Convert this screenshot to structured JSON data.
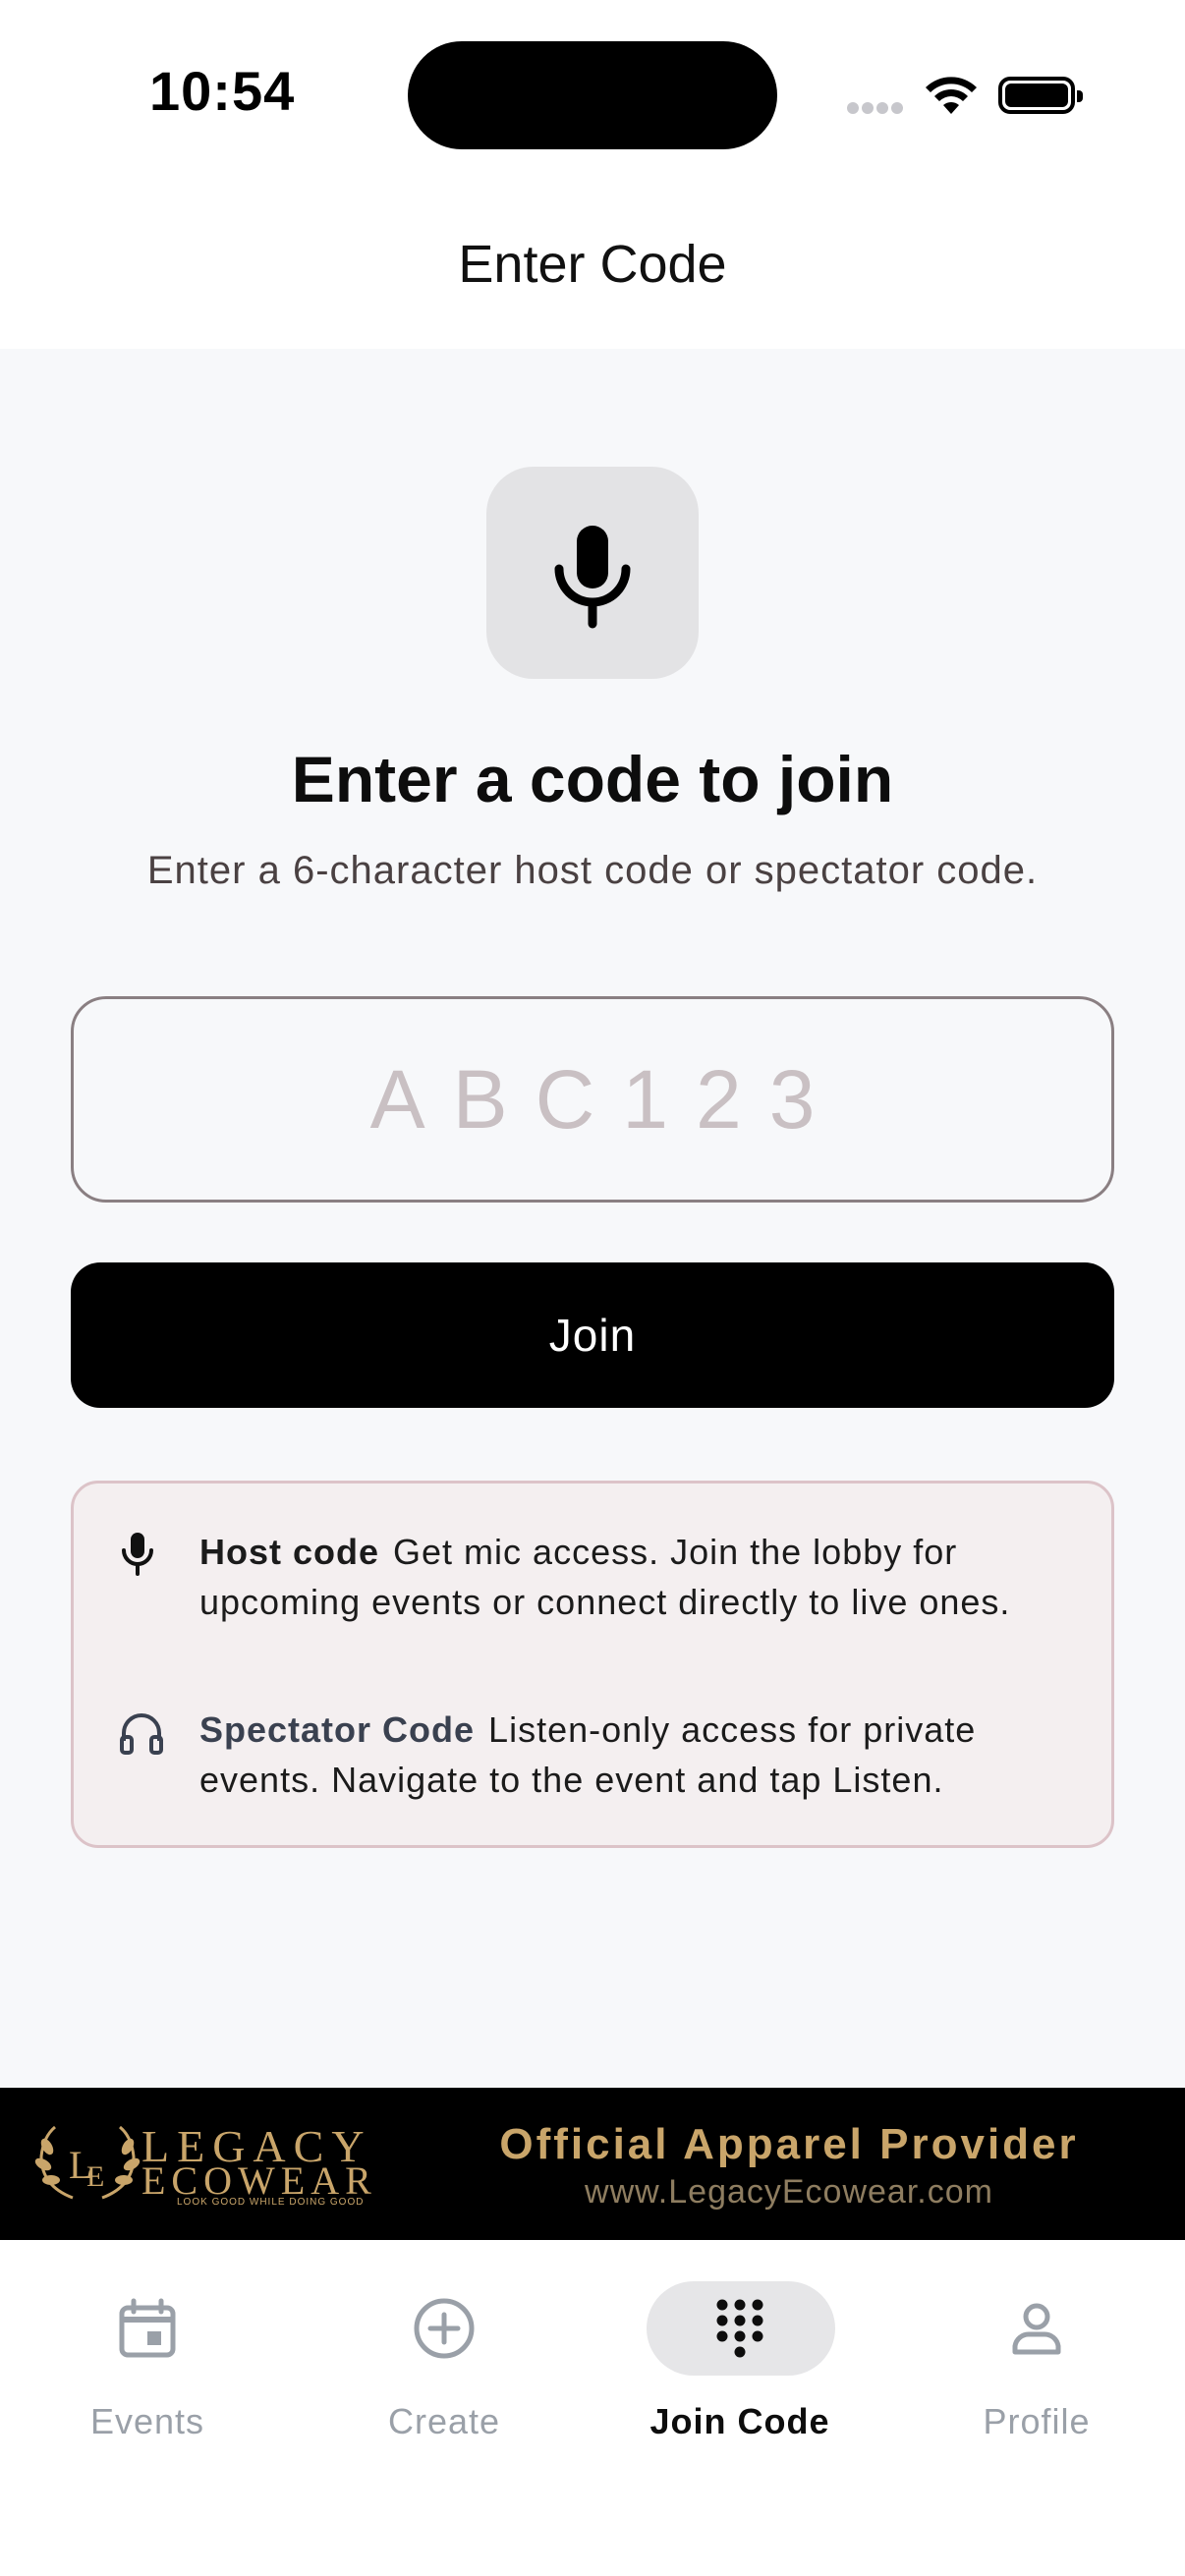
{
  "status_bar": {
    "time": "10:54"
  },
  "nav": {
    "title": "Enter Code"
  },
  "main": {
    "icon": "microphone-icon",
    "heading": "Enter a code to join",
    "subtitle": "Enter a 6-character host code or spectator code.",
    "input": {
      "value": "",
      "placeholder": "ABC123"
    },
    "join_label": "Join"
  },
  "info": {
    "host": {
      "label": "Host code",
      "text": "Get mic access. Join the lobby for upcoming events or connect directly to live ones.",
      "icon": "microphone-icon"
    },
    "spectator": {
      "label": "Spectator Code",
      "text": "Listen-only access for private events. Navigate to the event and tap Listen.",
      "icon": "headphones-icon"
    }
  },
  "banner": {
    "brand_line_1": "LEGACY",
    "brand_line_2": "ECOWEAR",
    "tagline": "LOOK GOOD WHILE DOING GOOD",
    "title": "Official Apparel Provider",
    "url": "www.LegacyEcowear.com"
  },
  "tabs": [
    {
      "label": "Events",
      "icon": "calendar-icon",
      "active": false
    },
    {
      "label": "Create",
      "icon": "plus-circle-icon",
      "active": false
    },
    {
      "label": "Join Code",
      "icon": "dialpad-icon",
      "active": true
    },
    {
      "label": "Profile",
      "icon": "person-icon",
      "active": false
    }
  ],
  "colors": {
    "accent_gold": "#c9a56a",
    "inactive_tab": "#9aa0a8",
    "card_bg": "#f4eff0",
    "card_border": "#dcc3c8"
  }
}
